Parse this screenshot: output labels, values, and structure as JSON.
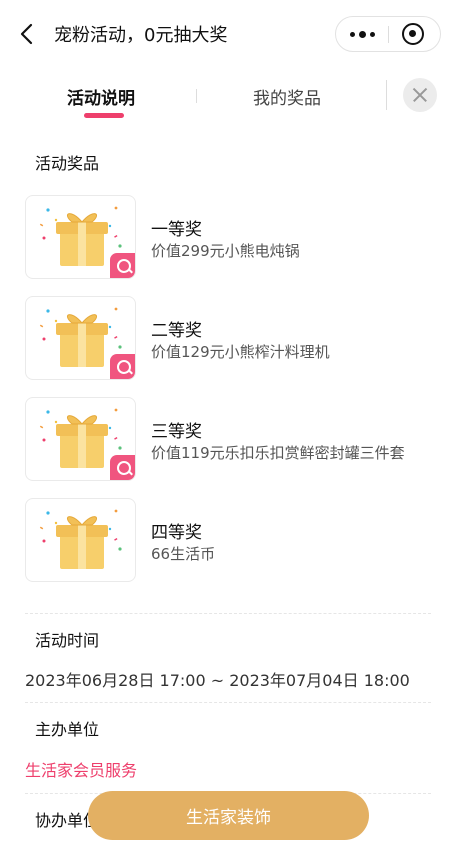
{
  "nav": {
    "title": "宠粉活动，0元抽大奖"
  },
  "tabs": [
    {
      "label": "活动说明"
    },
    {
      "label": "我的奖品"
    }
  ],
  "prizes_section": {
    "title": "活动奖品",
    "items": [
      {
        "name": "一等奖",
        "desc": "价值299元小熊电炖锅",
        "zoom": true
      },
      {
        "name": "二等奖",
        "desc": "价值129元小熊榨汁料理机",
        "zoom": true
      },
      {
        "name": "三等奖",
        "desc": "价值119元乐扣乐扣赏鲜密封罐三件套",
        "zoom": true
      },
      {
        "name": "四等奖",
        "desc": "66生活币",
        "zoom": false
      }
    ]
  },
  "time_section": {
    "title": "活动时间",
    "value": "2023年06月28日 17:00 ~ 2023年07月04日 18:00"
  },
  "organizer_section": {
    "title": "主办单位",
    "value": "生活家会员服务"
  },
  "co_organizer_section": {
    "title": "协办单位"
  },
  "cta": {
    "label": "生活家装饰"
  },
  "colors": {
    "accent": "#ee3f6c",
    "cta": "#e3b063",
    "highlight": "#fde6ed"
  }
}
